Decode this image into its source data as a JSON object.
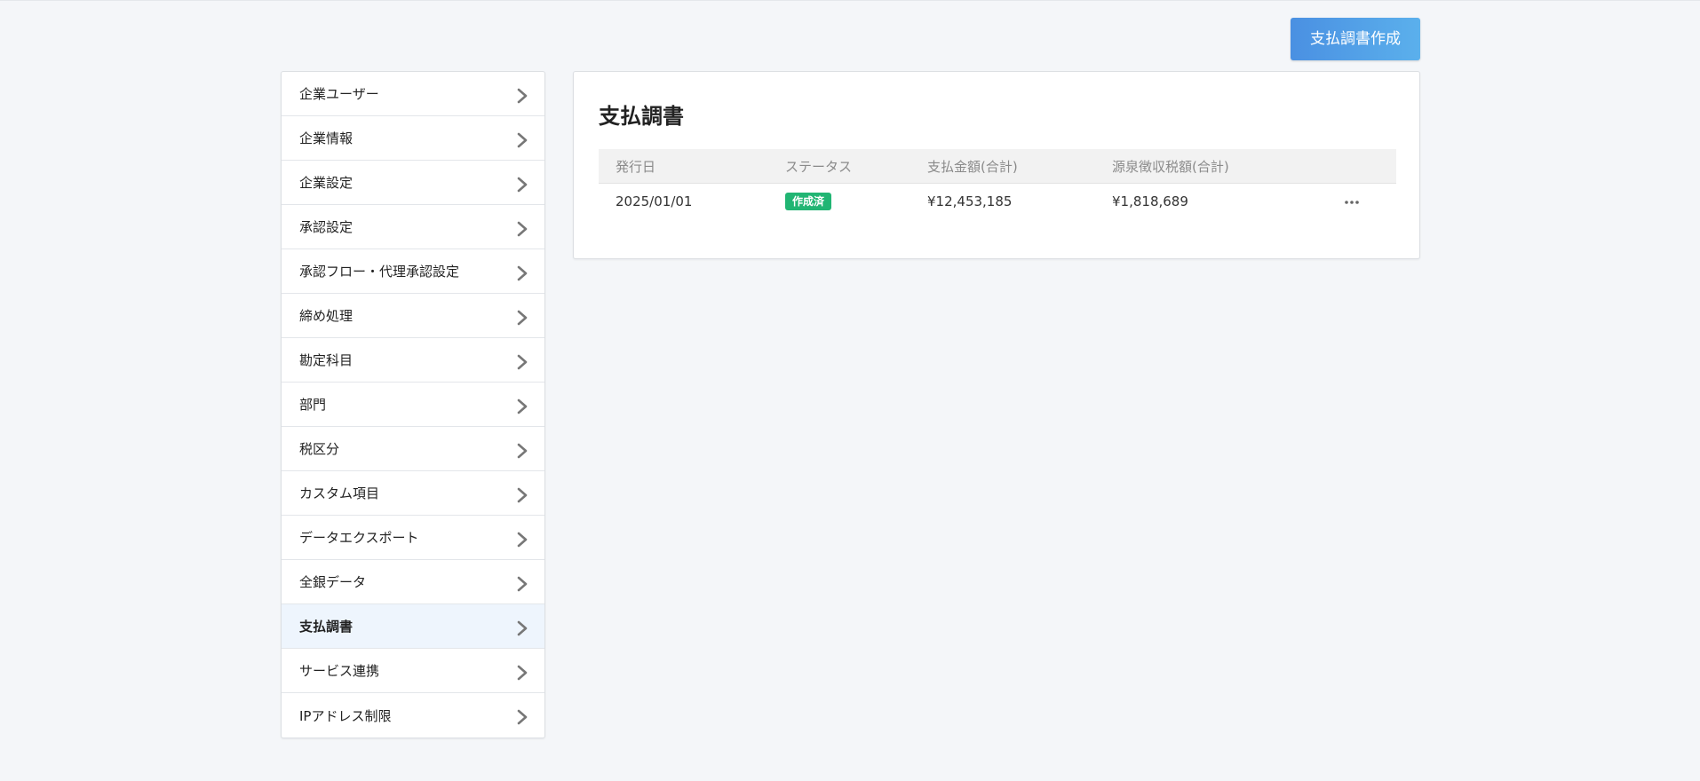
{
  "header": {
    "create_button_label": "支払調書作成"
  },
  "sidebar": {
    "items": [
      {
        "label": "企業ユーザー"
      },
      {
        "label": "企業情報"
      },
      {
        "label": "企業設定"
      },
      {
        "label": "承認設定"
      },
      {
        "label": "承認フロー・代理承認設定"
      },
      {
        "label": "締め処理"
      },
      {
        "label": "勘定科目"
      },
      {
        "label": "部門"
      },
      {
        "label": "税区分"
      },
      {
        "label": "カスタム項目"
      },
      {
        "label": "データエクスポート"
      },
      {
        "label": "全銀データ"
      },
      {
        "label": "支払調書",
        "active": true
      },
      {
        "label": "サービス連携"
      },
      {
        "label": "IPアドレス制限"
      }
    ],
    "item_icon": "chevron-right-icon"
  },
  "main": {
    "title": "支払調書",
    "table": {
      "columns": [
        "発行日",
        "ステータス",
        "支払金額(合計)",
        "源泉徴収税額(合計)",
        ""
      ],
      "rows": [
        {
          "issue_date": "2025/01/01",
          "status": "作成済",
          "payment_total": "¥12,453,185",
          "withholding_total": "¥1,818,689",
          "action_icon": "more-horizontal-icon"
        }
      ]
    }
  },
  "colors": {
    "accent": "#4a90e2",
    "status_done": "#21b573",
    "active_item_bg": "#eef5fd"
  }
}
